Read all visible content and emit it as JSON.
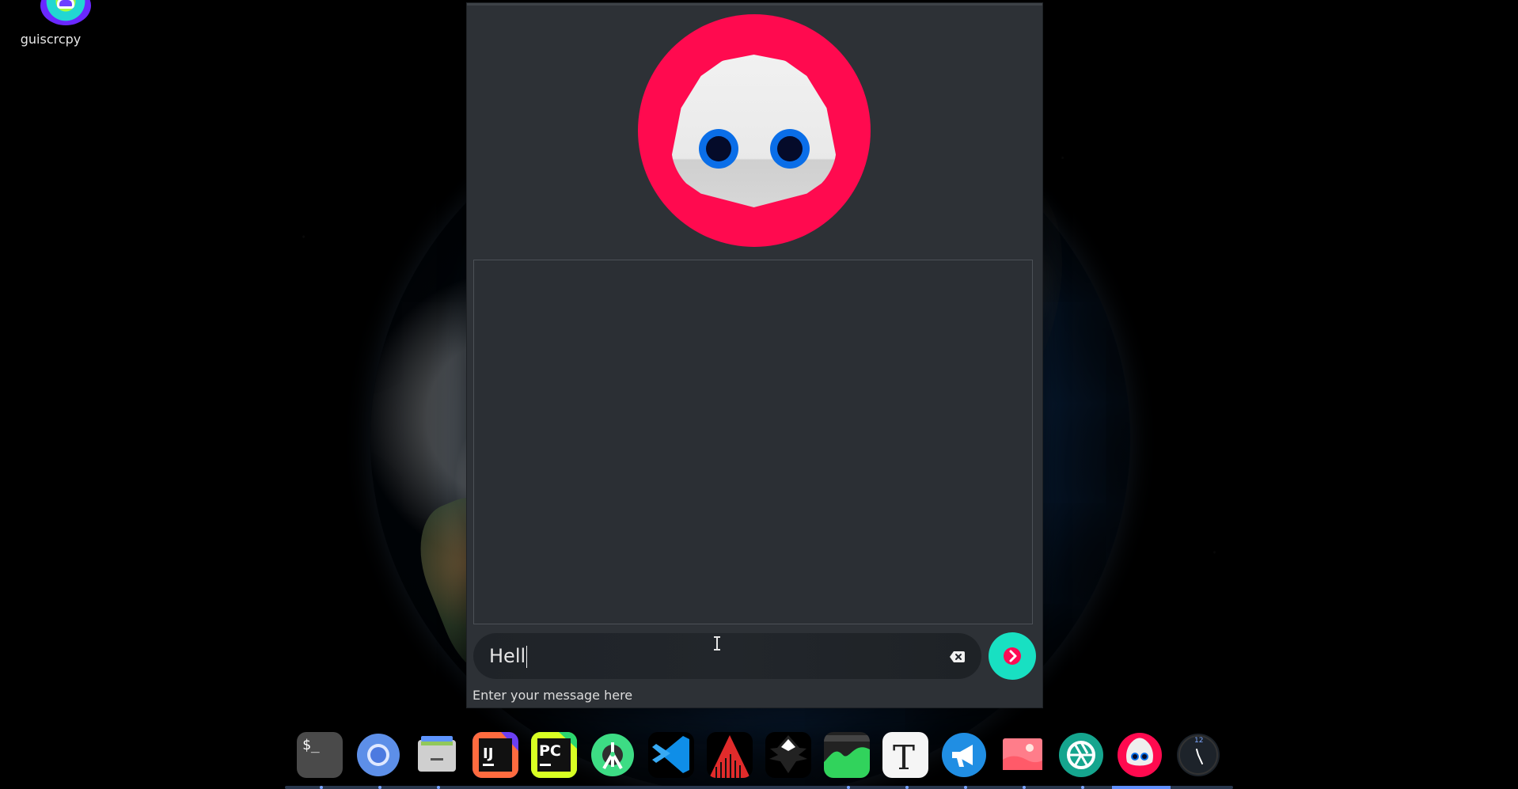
{
  "desktop": {
    "icons": [
      {
        "label": "guiscrcpy"
      }
    ]
  },
  "app": {
    "mascot": "robot-mascot-icon",
    "input": {
      "value": "Hell",
      "clear_icon": "backspace-x-icon",
      "send_icon": "chevron-right-icon"
    },
    "helper_text": "Enter your message here"
  },
  "dock": {
    "items": [
      "terminal-icon",
      "chromium-icon",
      "files-icon",
      "intellij-idea-icon",
      "pycharm-icon",
      "android-studio-icon",
      "vscode-icon",
      "audio-visualizer-icon",
      "inkscape-icon",
      "system-monitor-icon",
      "text-editor-icon",
      "megaphone-icon",
      "image-viewer-icon",
      "aperture-icon",
      "robot-mascot-icon",
      "clock-icon"
    ],
    "clock_text": "12"
  }
}
